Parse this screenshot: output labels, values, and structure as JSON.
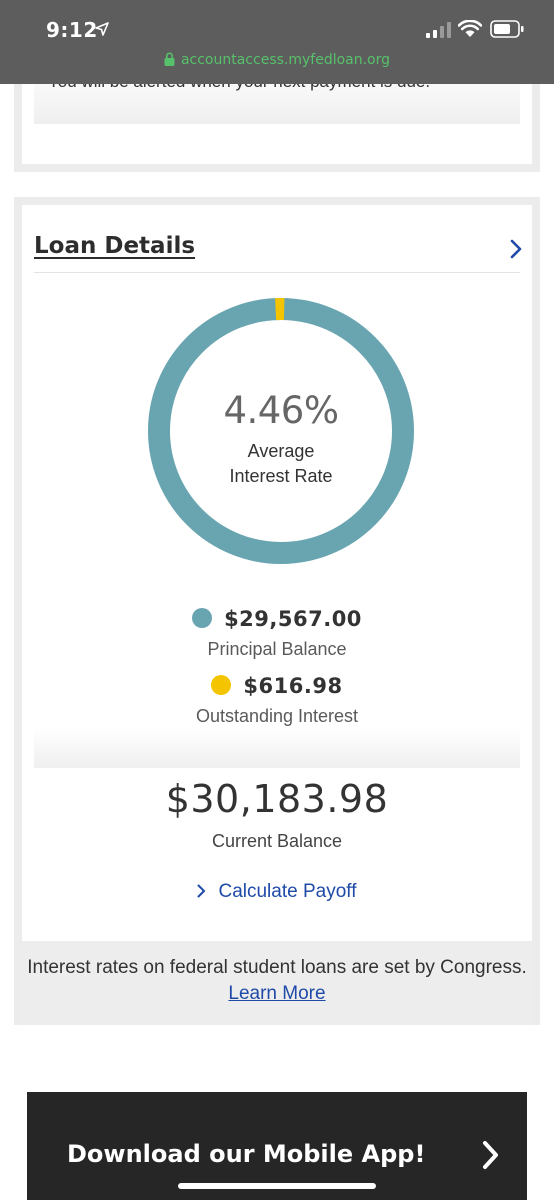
{
  "status_bar": {
    "time": "9:12",
    "url": "accountaccess.myfedloan.org",
    "url_color": "#56c16a"
  },
  "alert_card": {
    "text": "You will be alerted when your next payment is due."
  },
  "loan_details": {
    "title": "Loan Details",
    "average_rate": "4.46%",
    "rate_label_line1": "Average",
    "rate_label_line2": "Interest Rate",
    "principal": {
      "amount": "$29,567.00",
      "label": "Principal Balance",
      "color": "#69a5b0"
    },
    "interest": {
      "amount": "$616.98",
      "label": "Outstanding Interest",
      "color": "#f5c400"
    },
    "current_balance": "$30,183.98",
    "current_balance_label": "Current Balance",
    "calculate_payoff": "Calculate Payoff",
    "note_text": "Interest rates on federal student loans are set by Congress.",
    "note_link": "Learn More",
    "link_color": "#1f4aa8"
  },
  "app_banner": {
    "text": "Download our Mobile App!"
  }
}
